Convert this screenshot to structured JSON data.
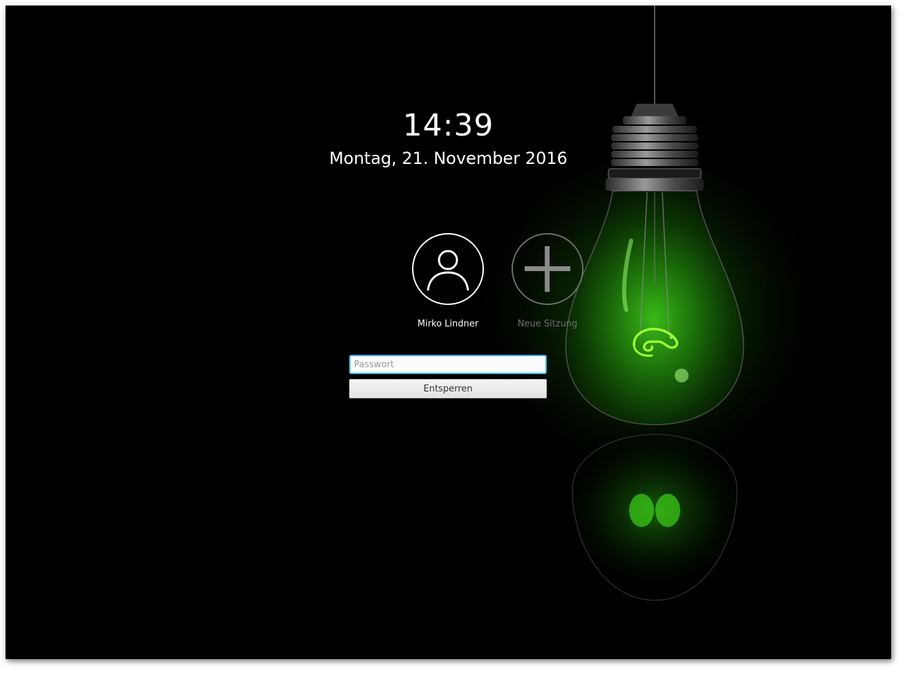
{
  "lockscreen": {
    "time": "14:39",
    "date": "Montag, 21. November 2016"
  },
  "users": [
    {
      "name": "Mirko Lindner",
      "icon": "user-icon",
      "state": "selected"
    },
    {
      "name": "Neue Sitzung",
      "icon": "plus-icon",
      "state": "inactive"
    }
  ],
  "login": {
    "password_placeholder": "Passwort",
    "password_value": "",
    "unlock_label": "Entsperren"
  },
  "wallpaper": {
    "subject": "lightbulb-icon",
    "logo": "chameleon-logo-icon",
    "accent_color": "#3ecf1a"
  },
  "colors": {
    "background": "#000000",
    "input_focus": "#3daee9",
    "text": "#ffffff",
    "muted_text": "#6e6e6e"
  }
}
